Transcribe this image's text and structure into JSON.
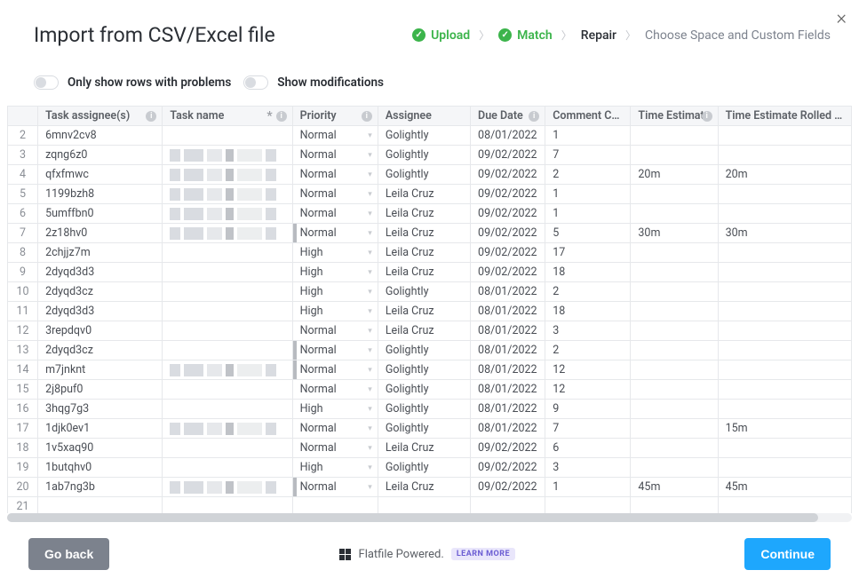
{
  "title": "Import from CSV/Excel file",
  "close_label": "×",
  "steps": {
    "upload": "Upload",
    "match": "Match",
    "repair": "Repair",
    "choose": "Choose Space and Custom Fields"
  },
  "filters": {
    "only_problems": "Only show rows with problems",
    "show_mods": "Show modifications"
  },
  "columns": {
    "task_assignees": "Task assignee(s)",
    "task_name": "Task name",
    "priority": "Priority",
    "assignee": "Assignee",
    "due_date": "Due Date",
    "comment_count": "Comment Count",
    "time_estimate": "Time Estimate",
    "time_estimate_rolled_up": "Time Estimate Rolled Up"
  },
  "rows": [
    {
      "n": "2",
      "task_assignees": "6mnv2cv8",
      "task_name_obscured": false,
      "priority": "Normal",
      "priority_bar": false,
      "assignee": "Golightly",
      "due_date": "08/01/2022",
      "comment_count": "1",
      "time_est": "",
      "time_ru": ""
    },
    {
      "n": "3",
      "task_assignees": "zqng6z0",
      "task_name_obscured": true,
      "priority": "Normal",
      "priority_bar": false,
      "assignee": "Golightly",
      "due_date": "09/02/2022",
      "comment_count": "7",
      "time_est": "",
      "time_ru": ""
    },
    {
      "n": "4",
      "task_assignees": "qfxfmwc",
      "task_name_obscured": true,
      "priority": "Normal",
      "priority_bar": false,
      "assignee": "Golightly",
      "due_date": "09/02/2022",
      "comment_count": "2",
      "time_est": "20m",
      "time_ru": "20m"
    },
    {
      "n": "5",
      "task_assignees": "1199bzh8",
      "task_name_obscured": true,
      "priority": "Normal",
      "priority_bar": false,
      "assignee": "Leila Cruz",
      "due_date": "09/02/2022",
      "comment_count": "1",
      "time_est": "",
      "time_ru": ""
    },
    {
      "n": "6",
      "task_assignees": "5umffbn0",
      "task_name_obscured": true,
      "priority": "Normal",
      "priority_bar": false,
      "assignee": "Leila Cruz",
      "due_date": "09/02/2022",
      "comment_count": "1",
      "time_est": "",
      "time_ru": ""
    },
    {
      "n": "7",
      "task_assignees": "2z18hv0",
      "task_name_obscured": true,
      "priority": "Normal",
      "priority_bar": true,
      "assignee": "Leila Cruz",
      "due_date": "09/02/2022",
      "comment_count": "5",
      "time_est": "30m",
      "time_ru": "30m"
    },
    {
      "n": "8",
      "task_assignees": "2chjjz7m",
      "task_name_obscured": false,
      "priority": "High",
      "priority_bar": false,
      "assignee": "Leila Cruz",
      "due_date": "09/02/2022",
      "comment_count": "17",
      "time_est": "",
      "time_ru": ""
    },
    {
      "n": "9",
      "task_assignees": "2dyqd3d3",
      "task_name_obscured": false,
      "priority": "High",
      "priority_bar": false,
      "assignee": "Leila Cruz",
      "due_date": "09/02/2022",
      "comment_count": "18",
      "time_est": "",
      "time_ru": ""
    },
    {
      "n": "10",
      "task_assignees": "2dyqd3cz",
      "task_name_obscured": false,
      "priority": "High",
      "priority_bar": false,
      "assignee": "Golightly",
      "due_date": "08/01/2022",
      "comment_count": "2",
      "time_est": "",
      "time_ru": ""
    },
    {
      "n": "11",
      "task_assignees": "2dyqd3d3",
      "task_name_obscured": false,
      "priority": "High",
      "priority_bar": false,
      "assignee": "Leila Cruz",
      "due_date": "08/01/2022",
      "comment_count": "18",
      "time_est": "",
      "time_ru": ""
    },
    {
      "n": "12",
      "task_assignees": "3repdqv0",
      "task_name_obscured": false,
      "priority": "Normal",
      "priority_bar": false,
      "assignee": "Leila Cruz",
      "due_date": "08/01/2022",
      "comment_count": "3",
      "time_est": "",
      "time_ru": ""
    },
    {
      "n": "13",
      "task_assignees": "2dyqd3cz",
      "task_name_obscured": false,
      "priority": "Normal",
      "priority_bar": true,
      "assignee": "Golightly",
      "due_date": "08/01/2022",
      "comment_count": "2",
      "time_est": "",
      "time_ru": ""
    },
    {
      "n": "14",
      "task_assignees": "m7jnknt",
      "task_name_obscured": true,
      "priority": "Normal",
      "priority_bar": true,
      "assignee": "Golightly",
      "due_date": "08/01/2022",
      "comment_count": "12",
      "time_est": "",
      "time_ru": ""
    },
    {
      "n": "15",
      "task_assignees": "2j8puf0",
      "task_name_obscured": false,
      "priority": "Normal",
      "priority_bar": false,
      "assignee": "Golightly",
      "due_date": "08/01/2022",
      "comment_count": "12",
      "time_est": "",
      "time_ru": ""
    },
    {
      "n": "16",
      "task_assignees": "3hqg7g3",
      "task_name_obscured": false,
      "priority": "High",
      "priority_bar": false,
      "assignee": "Golightly",
      "due_date": "08/01/2022",
      "comment_count": "9",
      "time_est": "",
      "time_ru": ""
    },
    {
      "n": "17",
      "task_assignees": "1djk0ev1",
      "task_name_obscured": true,
      "priority": "Normal",
      "priority_bar": false,
      "assignee": "Golightly",
      "due_date": "08/01/2022",
      "comment_count": "7",
      "time_est": "",
      "time_ru": "15m"
    },
    {
      "n": "18",
      "task_assignees": "1v5xaq90",
      "task_name_obscured": false,
      "priority": "Normal",
      "priority_bar": false,
      "assignee": "Leila Cruz",
      "due_date": "09/02/2022",
      "comment_count": "6",
      "time_est": "",
      "time_ru": ""
    },
    {
      "n": "19",
      "task_assignees": "1butqhv0",
      "task_name_obscured": false,
      "priority": "High",
      "priority_bar": false,
      "assignee": "Golightly",
      "due_date": "09/02/2022",
      "comment_count": "3",
      "time_est": "",
      "time_ru": ""
    },
    {
      "n": "20",
      "task_assignees": "1ab7ng3b",
      "task_name_obscured": true,
      "priority": "Normal",
      "priority_bar": true,
      "assignee": "Leila Cruz",
      "due_date": "09/02/2022",
      "comment_count": "1",
      "time_est": "45m",
      "time_ru": "45m"
    },
    {
      "n": "21",
      "task_assignees": "",
      "task_name_obscured": false,
      "priority": "",
      "priority_bar": false,
      "assignee": "",
      "due_date": "",
      "comment_count": "",
      "time_est": "",
      "time_ru": ""
    }
  ],
  "footer": {
    "back": "Go back",
    "powered": "Flatfile Powered.",
    "learn": "LEARN MORE",
    "continue": "Continue"
  }
}
